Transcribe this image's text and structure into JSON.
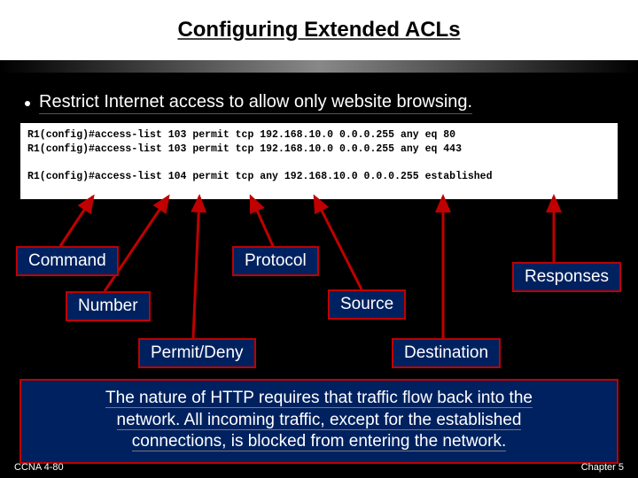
{
  "title": "Configuring Extended ACLs",
  "bullet": "Restrict Internet access to allow only website browsing.",
  "code": {
    "line1": "R1(config)#access-list 103 permit tcp 192.168.10.0 0.0.0.255 any eq 80",
    "line2": "R1(config)#access-list 103 permit tcp 192.168.10.0 0.0.0.255 any eq 443",
    "line3": "R1(config)#access-list 104 permit tcp any 192.168.10.0 0.0.0.255 established"
  },
  "labels": {
    "command": "Command",
    "protocol": "Protocol",
    "responses": "Responses",
    "number": "Number",
    "source": "Source",
    "permitdeny": "Permit/Deny",
    "destination": "Destination"
  },
  "note": {
    "part1": "The nature of HTTP requires that traffic flow back into the",
    "part2a": "network.  All incoming traffic, ",
    "part2b": "except for the established",
    "part3a": "connections,",
    "part3b": " is blocked from entering the network."
  },
  "footer": {
    "left": "CCNA 4-80",
    "right": "Chapter 5"
  }
}
